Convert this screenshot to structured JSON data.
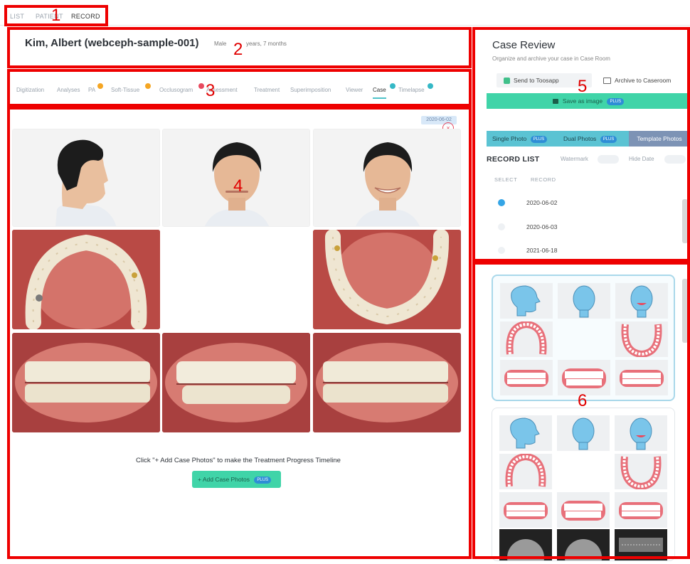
{
  "topnav": {
    "items": [
      {
        "label": "LIST",
        "active": false
      },
      {
        "label": "PATIENT",
        "active": false
      },
      {
        "label": "RECORD",
        "active": true
      }
    ]
  },
  "patient": {
    "name": "Kim, Albert (webceph-sample-001)",
    "sex": "Male",
    "age": "years, 7 months"
  },
  "tabs": [
    {
      "label": "Digitization",
      "badge": ""
    },
    {
      "label": "Analyses",
      "badge": ""
    },
    {
      "label": "PA",
      "badge": "orange"
    },
    {
      "label": "Soft-Tissue",
      "badge": "orange"
    },
    {
      "label": "Occlusogram",
      "badge": "red"
    },
    {
      "label": "Assessment",
      "badge": ""
    },
    {
      "label": "Treatment",
      "badge": ""
    },
    {
      "label": "Superimposition",
      "badge": ""
    },
    {
      "label": "Viewer",
      "badge": ""
    },
    {
      "label": "Case",
      "badge": "teal",
      "active": true
    },
    {
      "label": "Timelapse",
      "badge": "teal"
    }
  ],
  "case_panel": {
    "date_chip": "2020-06-02",
    "close_glyph": "×",
    "timeline_message": "Click \"+ Add Case Photos\" to make the Treatment Progress Timeline",
    "add_button_label": "+ Add Case Photos",
    "plus_badge": "PLUS"
  },
  "case_review": {
    "title": "Case Review",
    "subtitle": "Organize and archive your case in Case Room",
    "send_button": "Send to Toosapp",
    "archive_button": "Archive to Caseroom",
    "save_button": "Save as image",
    "plus_badge": "PLUS",
    "modes": {
      "single": "Single Photo",
      "dual": "Dual Photos",
      "template": "Template Photos"
    },
    "record_list_title": "RECORD LIST",
    "watermark_label": "Watermark",
    "hide_date_label": "Hide Date",
    "col_select": "SELECT",
    "col_record": "RECORD",
    "records": [
      {
        "date": "2020-06-02",
        "selected": true
      },
      {
        "date": "2020-06-03",
        "selected": false
      },
      {
        "date": "2021-06-18",
        "selected": false
      }
    ]
  },
  "annotations": {
    "labels": [
      "1",
      "2",
      "3",
      "4",
      "5",
      "6"
    ]
  },
  "colors": {
    "accent_green": "#40d4a8",
    "accent_teal": "#35b8c6",
    "annotation_red": "#ee0000",
    "segment_teal": "#5bc3d3",
    "segment_slate": "#7d93b5"
  }
}
